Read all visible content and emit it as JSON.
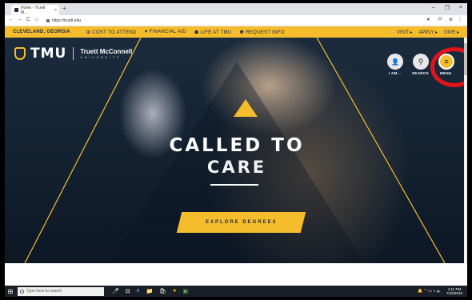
{
  "browser": {
    "tab_title": "Home - Truett M...",
    "tab_close": "×",
    "new_tab": "+",
    "url": "https://truett.edu",
    "nav": {
      "back": "←",
      "forward": "→",
      "reload": "C",
      "home": "⌂"
    },
    "window_controls": {
      "minimize": "–",
      "maximize": "❐",
      "close": "×"
    },
    "extensions": {
      "star": "★",
      "ext1": "◘",
      "ext2": "⊕",
      "menu": "⋮"
    }
  },
  "site_nav": {
    "location": "CLEVELAND, GEORGIA",
    "items": [
      {
        "icon": "⊞",
        "label": "COST TO ATTEND"
      },
      {
        "icon": "♥",
        "label": "FINANCIAL AID"
      },
      {
        "icon": "☗",
        "label": "LIFE AT TMU"
      },
      {
        "icon": "❶",
        "label": "REQUEST INFO"
      }
    ],
    "right": [
      "VISIT ▸",
      "APPLY ▸",
      "GIVE ▸"
    ]
  },
  "header": {
    "logo_abbr": "TMU",
    "logo_name": "Truett McConnell",
    "logo_sub": "UNIVERSITY",
    "buttons": [
      {
        "label": "I AM...",
        "icon": "👤"
      },
      {
        "label": "SEARCH",
        "icon": "⚲"
      },
      {
        "label": "MENU",
        "icon": "≡"
      }
    ]
  },
  "hero": {
    "headline_1": "CALLED TO",
    "headline_2": "CARE",
    "cta": "EXPLORE DEGREES"
  },
  "taskbar": {
    "start": "⊞",
    "search_placeholder": "Type here to search",
    "pinned": [
      "🎤",
      "⊟",
      "e",
      "📁",
      "🛍",
      "●",
      "▣"
    ],
    "tray_icons": "🔔 ⌃ ▭ ◖ 🔈",
    "time": "1:11 PM",
    "date": "7/16/2019"
  },
  "colors": {
    "brand_gold": "#f5bd2c",
    "brand_navy": "#1d2740",
    "highlight_red": "#e3131b"
  }
}
